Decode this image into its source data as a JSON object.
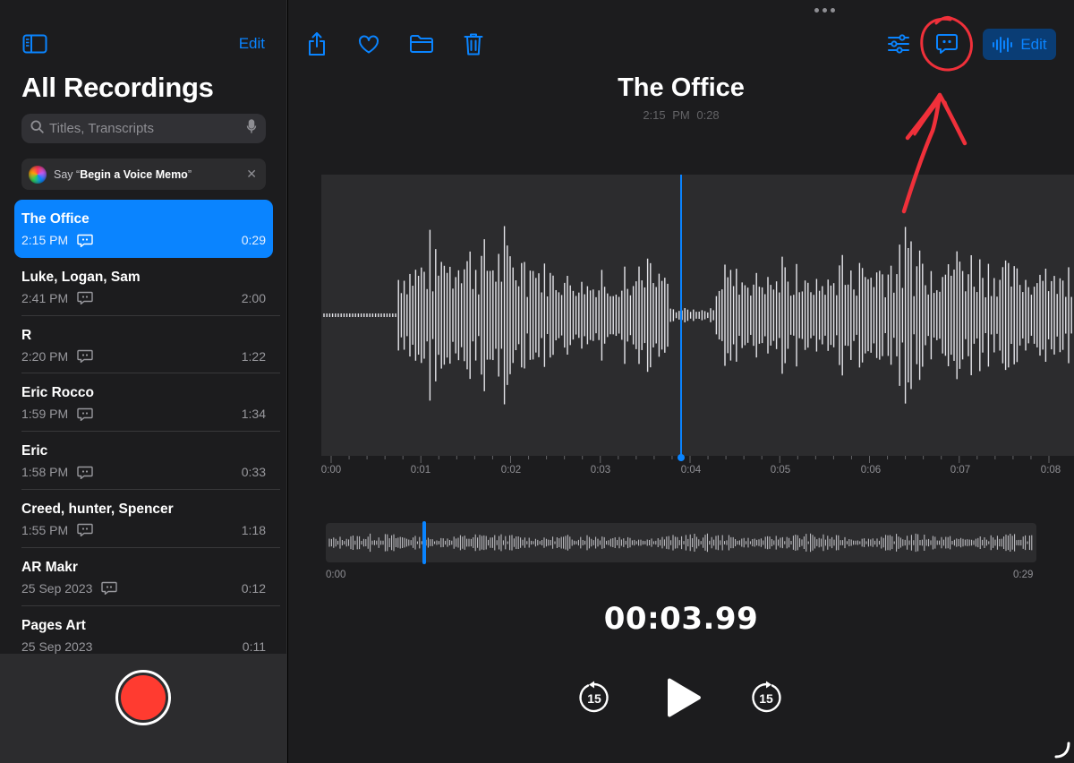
{
  "sidebar": {
    "edit_label": "Edit",
    "title": "All Recordings",
    "search_placeholder": "Titles, Transcripts",
    "siri_prefix": "Say “",
    "siri_phrase": "Begin a Voice Memo",
    "siri_suffix": "”",
    "recordings": [
      {
        "name": "The Office",
        "date": "2:15 PM",
        "duration": "0:29",
        "selected": true
      },
      {
        "name": "Luke, Logan, Sam",
        "date": "2:41 PM",
        "duration": "2:00"
      },
      {
        "name": "R",
        "date": "2:20 PM",
        "duration": "1:22"
      },
      {
        "name": "Eric Rocco",
        "date": "1:59 PM",
        "duration": "1:34"
      },
      {
        "name": "Eric",
        "date": "1:58 PM",
        "duration": "0:33"
      },
      {
        "name": "Creed, hunter, Spencer",
        "date": "1:55 PM",
        "duration": "1:18"
      },
      {
        "name": "AR Makr",
        "date": "25 Sep 2023",
        "duration": "0:12"
      },
      {
        "name": "Pages Art",
        "date": "25 Sep 2023",
        "duration": "0:11"
      }
    ]
  },
  "toolbar": {
    "icons": [
      "share-icon",
      "heart-icon",
      "folder-icon",
      "trash-icon",
      "settings-sliders-icon",
      "transcript-icon",
      "waveform-icon"
    ],
    "edit_label": "Edit"
  },
  "detail": {
    "title": "The Office",
    "time": "2:15 PM",
    "duration": "0:28",
    "ruler_labels": [
      "0:00",
      "0:01",
      "0:02",
      "0:03",
      "0:04",
      "0:05",
      "0:06",
      "0:07",
      "0:08"
    ],
    "overview_start": "0:00",
    "overview_end": "0:29",
    "current_time": "00:03.99",
    "skip_back_label": "15",
    "skip_forward_label": "15",
    "playhead_fraction": 0.138
  },
  "colors": {
    "accent": "#0a84ff",
    "record": "#ff3b30",
    "annotation": "#f0303a"
  }
}
